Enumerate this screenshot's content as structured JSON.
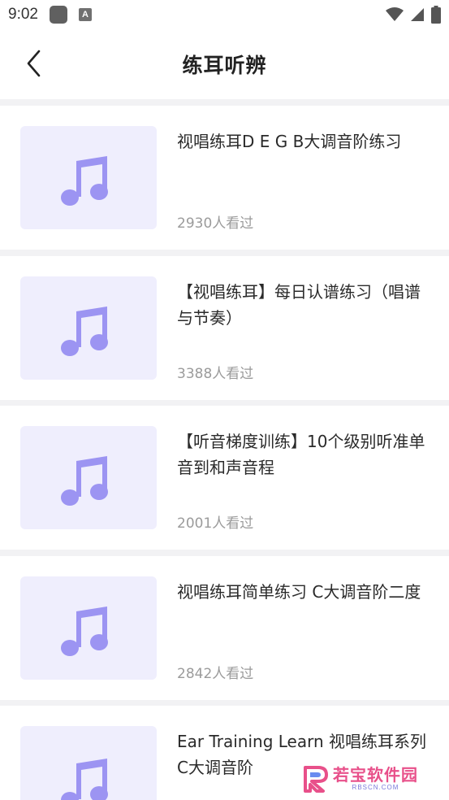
{
  "status_bar": {
    "time": "9:02",
    "a_icon_text": "A"
  },
  "header": {
    "title": "练耳听辨"
  },
  "colors": {
    "accent": "#9c94f2",
    "thumb_bg": "#efeefd",
    "views": "#9b9b9b"
  },
  "items": [
    {
      "title": "视唱练耳D E G B大调音阶练习",
      "views": "2930人看过",
      "icon": "music-note-icon"
    },
    {
      "title": "【视唱练耳】每日认谱练习（唱谱与节奏）",
      "views": "3388人看过",
      "icon": "music-note-icon"
    },
    {
      "title": "【听音梯度训练】10个级别听准单音到和声音程",
      "views": "2001人看过",
      "icon": "music-note-icon"
    },
    {
      "title": "视唱练耳简单练习 C大调音阶二度",
      "views": "2842人看过",
      "icon": "music-note-icon"
    },
    {
      "title": "Ear Training Learn 视唱练耳系列C大调音阶",
      "views": "",
      "icon": "music-note-icon"
    }
  ],
  "watermark": {
    "main": "若宝软件园",
    "sub": "RBSCN.COM"
  }
}
